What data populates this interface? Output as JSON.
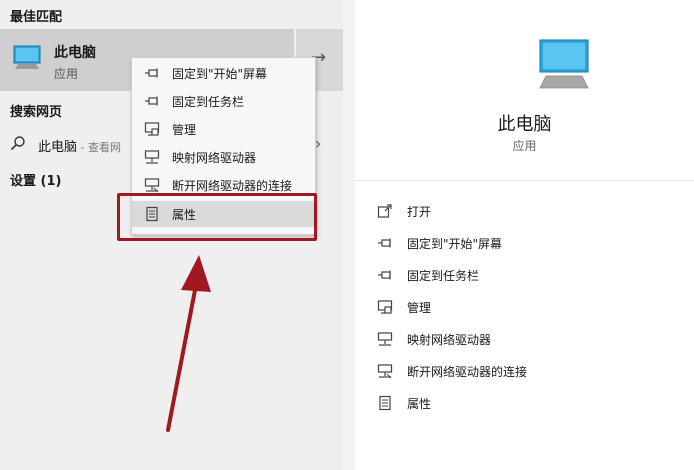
{
  "best_match": {
    "heading": "最佳匹配",
    "name": "此电脑",
    "type": "应用",
    "arrow": "→"
  },
  "web": {
    "heading": "搜索网页",
    "query": "此电脑",
    "hint": " - 查看网",
    "chevron": "›"
  },
  "settings": {
    "heading": "设置 (1)"
  },
  "context_menu": {
    "items": [
      {
        "label": "固定到\"开始\"屏幕",
        "icon": "pin-icon"
      },
      {
        "label": "固定到任务栏",
        "icon": "pin-icon"
      },
      {
        "label": "管理",
        "icon": "manage-icon"
      },
      {
        "label": "映射网络驱动器",
        "icon": "network-drive-icon"
      },
      {
        "label": "断开网络驱动器的连接",
        "icon": "disconnect-drive-icon"
      },
      {
        "label": "属性",
        "icon": "properties-icon"
      }
    ],
    "highlighted_index": 5
  },
  "detail": {
    "name": "此电脑",
    "type": "应用",
    "actions": [
      {
        "label": "打开",
        "icon": "open-icon"
      },
      {
        "label": "固定到\"开始\"屏幕",
        "icon": "pin-icon"
      },
      {
        "label": "固定到任务栏",
        "icon": "pin-icon"
      },
      {
        "label": "管理",
        "icon": "manage-icon"
      },
      {
        "label": "映射网络驱动器",
        "icon": "network-drive-icon"
      },
      {
        "label": "断开网络驱动器的连接",
        "icon": "disconnect-drive-icon"
      },
      {
        "label": "属性",
        "icon": "properties-icon"
      }
    ]
  },
  "colors": {
    "highlight_annotation": "#a01820",
    "selected_bg": "#cfcfcf",
    "icon_blue": "#2aa8e0"
  }
}
